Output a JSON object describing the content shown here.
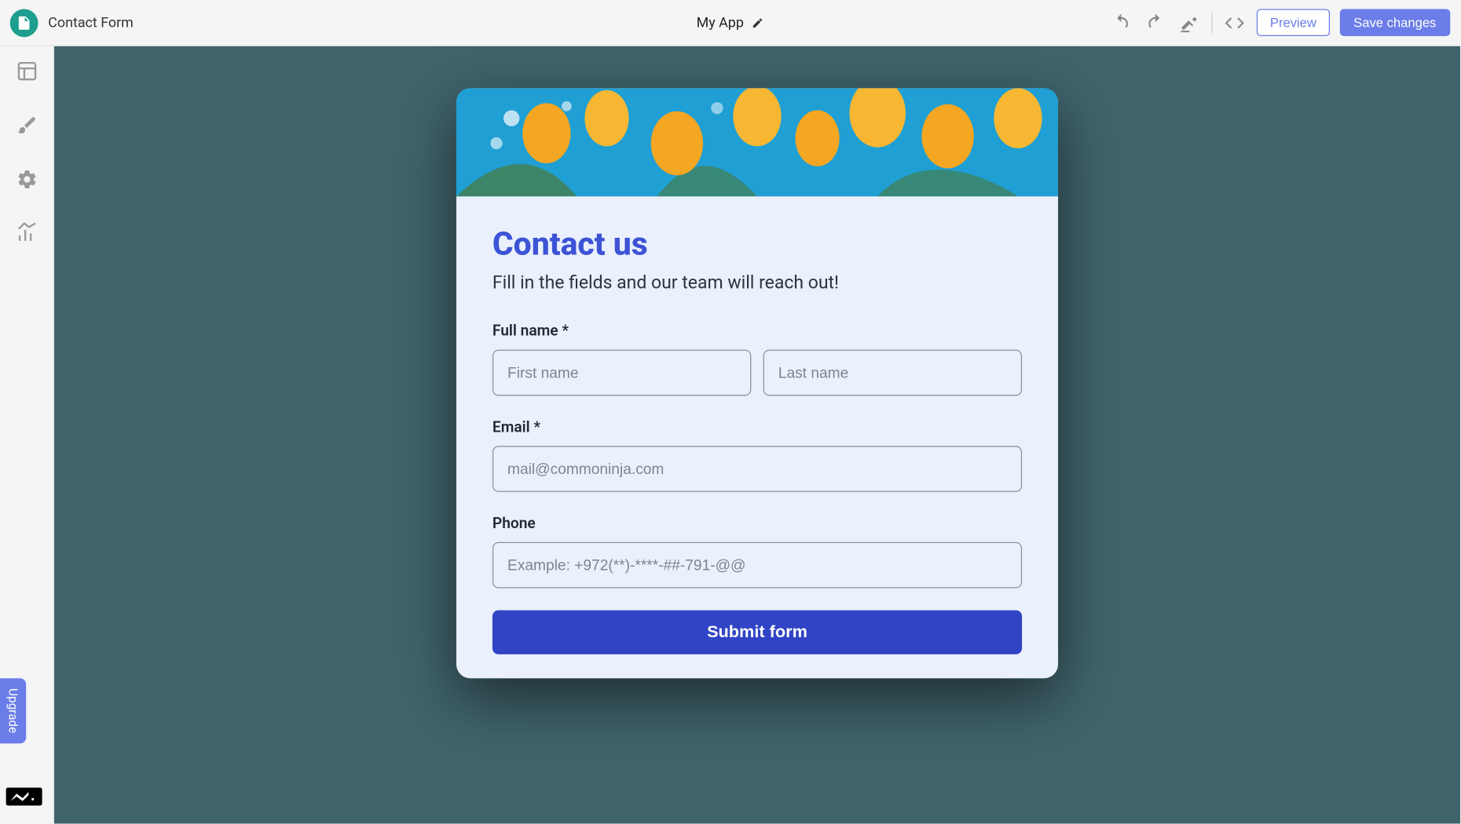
{
  "header": {
    "page_name": "Contact Form",
    "app_name": "My App",
    "preview_label": "Preview",
    "save_label": "Save changes"
  },
  "sidebar": {
    "upgrade_label": "Upgrade"
  },
  "form": {
    "title": "Contact us",
    "subtitle": "Fill in the fields and our team will reach out!",
    "fullname_label": "Full name *",
    "firstname_placeholder": "First name",
    "lastname_placeholder": "Last name",
    "email_label": "Email *",
    "email_placeholder": "mail@commoninja.com",
    "phone_label": "Phone",
    "phone_placeholder": "Example: +972(**)-****-##-791-@@",
    "submit_label": "Submit form"
  },
  "colors": {
    "accent": "#6a7de8",
    "form_title": "#3d53d6",
    "submit": "#3044c5",
    "canvas_bg": "#40646c"
  }
}
